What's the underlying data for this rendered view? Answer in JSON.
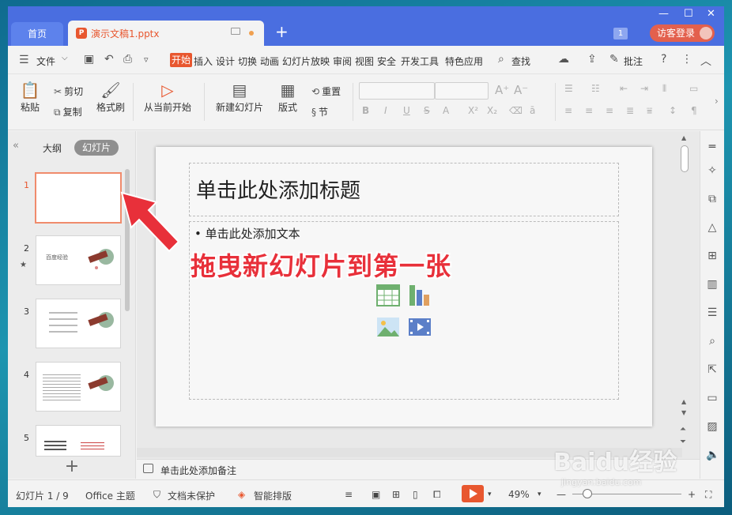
{
  "titlebar": {
    "home_tab": "首页",
    "doc_tab": "演示文稿1.pptx",
    "doc_icon": "P",
    "new_tab": "+",
    "badge": "1",
    "login": "访客登录",
    "minimize": "—",
    "maximize": "☐",
    "close": "✕"
  },
  "menu": {
    "file": "文件",
    "tabs": [
      "开始",
      "插入",
      "设计",
      "切换",
      "动画",
      "幻灯片放映",
      "审阅",
      "视图",
      "安全",
      "开发工具",
      "特色应用"
    ],
    "active_tab": "开始",
    "search": "查找",
    "annotate": "批注"
  },
  "ribbon": {
    "paste": "粘贴",
    "cut": "剪切",
    "copy": "复制",
    "format_painter": "格式刷",
    "from_current": "从当前开始",
    "new_slide": "新建幻灯片",
    "layout": "版式",
    "reset": "重置",
    "section": "节",
    "font_tools": [
      "B",
      "I",
      "U",
      "S",
      "A",
      "X²",
      "X₂",
      "ā"
    ]
  },
  "left_panel": {
    "outline_tab": "大纲",
    "slides_tab": "幻灯片",
    "thumbnails": [
      {
        "num": "1",
        "selected": true,
        "text": ""
      },
      {
        "num": "2",
        "selected": false,
        "text": "百度经验"
      },
      {
        "num": "3",
        "selected": false,
        "text": ""
      },
      {
        "num": "4",
        "selected": false,
        "text": ""
      },
      {
        "num": "5",
        "selected": false,
        "text": ""
      }
    ],
    "add": "+"
  },
  "slide": {
    "title_placeholder": "单击此处添加标题",
    "body_placeholder": "• 单击此处添加文本",
    "annotation": "拖曳新幻灯片到第一张"
  },
  "notes": {
    "placeholder": "单击此处添加备注"
  },
  "status": {
    "slide_counter": "幻灯片 1 / 9",
    "theme": "Office 主题",
    "protection": "文档未保护",
    "smart_layout": "智能排版",
    "zoom": "49%",
    "zoom_minus": "—"
  },
  "watermark": {
    "brand": "Baidu经验",
    "url": "jingyan.baidu.com"
  },
  "colors": {
    "accent": "#e8572f",
    "titlebar": "#4a6ee0",
    "annotation": "#e8303a"
  }
}
